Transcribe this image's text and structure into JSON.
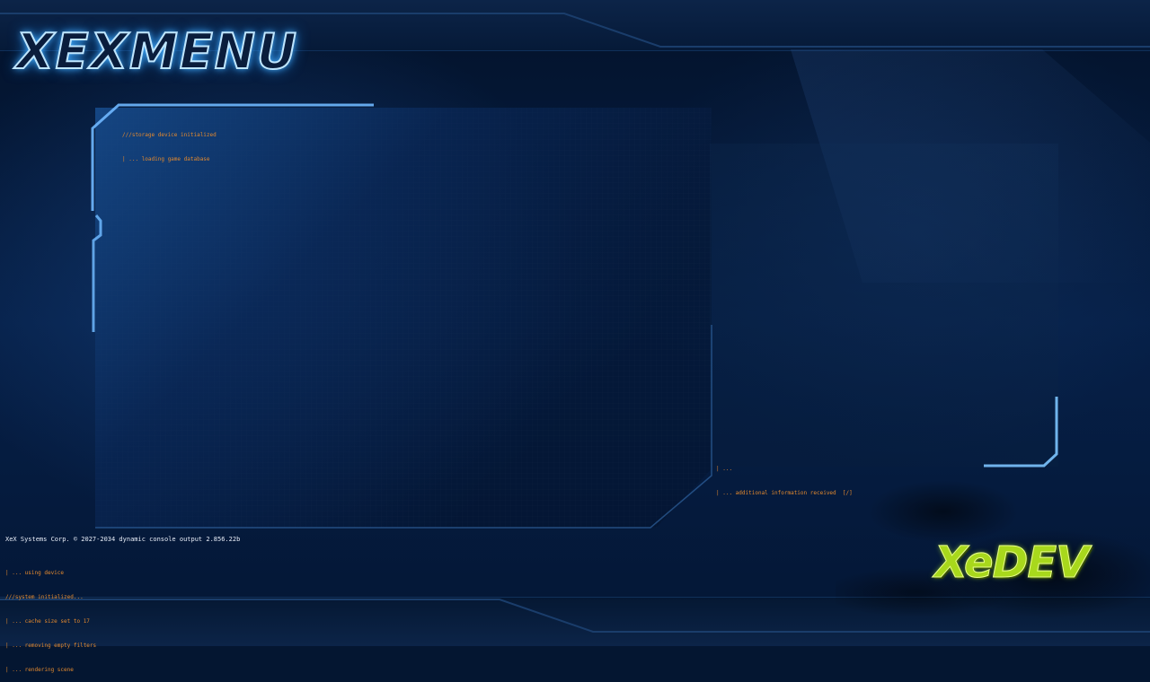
{
  "app": {
    "logo_text": "XEXMENU",
    "brand_text": "XeDEV"
  },
  "log_main": [
    "///storage device initialized",
    "| ... loading game database"
  ],
  "log_right": [
    "| ...",
    "| ... additional information received  [/]"
  ],
  "footer": {
    "copyright": "XeX Systems Corp. © 2027-2034 dynamic console output 2.856.22b"
  },
  "log_bottom": [
    "| ... using device",
    "///system initialized...",
    "| ... cache size set to 17",
    "| ... removing empty filters",
    "| ... rendering scene"
  ],
  "colors": {
    "accent_blue": "#6fb8ff",
    "log_orange": "#e3892e",
    "brand_green": "#a8d81c"
  }
}
